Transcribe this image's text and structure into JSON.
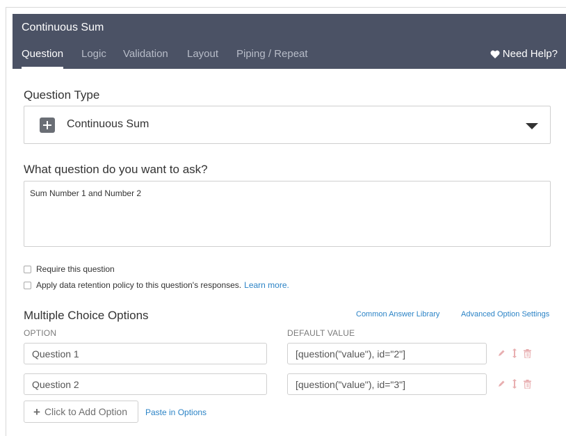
{
  "header": {
    "title": "Continuous Sum",
    "tabs": [
      {
        "label": "Question",
        "active": true
      },
      {
        "label": "Logic",
        "active": false
      },
      {
        "label": "Validation",
        "active": false
      },
      {
        "label": "Layout",
        "active": false
      },
      {
        "label": "Piping / Repeat",
        "active": false
      }
    ],
    "help_label": "Need Help?",
    "help_icon": "heart-icon"
  },
  "question_type": {
    "label": "Question Type",
    "selected": "Continuous Sum",
    "icon": "plus-square-icon"
  },
  "question_text": {
    "label": "What question do you want to ask?",
    "value": "Sum Number 1 and Number 2"
  },
  "options": {
    "require_label": "Require this question",
    "retention_label": "Apply data retention policy to this question's responses.",
    "learn_more": "Learn more."
  },
  "mc": {
    "heading": "Multiple Choice Options",
    "common_library": "Common Answer Library",
    "advanced_settings": "Advanced Option Settings",
    "col_option": "OPTION",
    "col_default": "DEFAULT VALUE",
    "rows": [
      {
        "option": "Question 1",
        "default_value": "[question(\"value\"), id=\"2\"]"
      },
      {
        "option": "Question 2",
        "default_value": "[question(\"value\"), id=\"3\"]"
      }
    ],
    "add_option": "Click to Add Option",
    "paste_options": "Paste in Options"
  },
  "colors": {
    "header_bg": "#4b5265",
    "link": "#2b83c6",
    "row_action_muted": "#e8aeb0"
  }
}
